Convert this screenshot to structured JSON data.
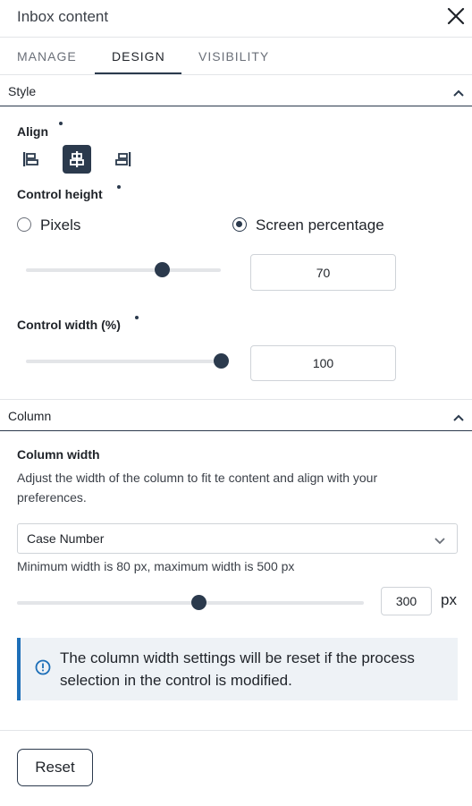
{
  "header": {
    "title": "Inbox content"
  },
  "tabs": [
    {
      "label": "MANAGE",
      "active": false
    },
    {
      "label": "DESIGN",
      "active": true
    },
    {
      "label": "VISIBILITY",
      "active": false
    }
  ],
  "style_section": {
    "title": "Style",
    "align": {
      "label": "Align",
      "options": [
        "align-left-icon",
        "align-center-icon",
        "align-right-icon"
      ],
      "selected": "center"
    },
    "control_height": {
      "label": "Control height",
      "options": [
        {
          "label": "Pixels",
          "selected": false
        },
        {
          "label": "Screen percentage",
          "selected": true
        }
      ],
      "value": "70",
      "slider_fraction": 0.7
    },
    "control_width": {
      "label": "Control width (%)",
      "value": "100",
      "slider_fraction": 1.0
    }
  },
  "column_section": {
    "title": "Column",
    "column_width": {
      "label": "Column width",
      "description": "Adjust the width of the column to fit te content and align with your preferences.",
      "select_value": "Case Number",
      "range_hint": "Minimum width is 80 px, maximum width is 500 px",
      "value": "300",
      "unit": "px",
      "min": 80,
      "max": 500
    },
    "info_message": "The column width settings will be reset if the process selection in the control is modified."
  },
  "footer": {
    "reset_label": "Reset"
  },
  "colors": {
    "primary": "#2b3a4d",
    "info_accent": "#1d6fb8",
    "info_bg": "#eef2f6",
    "divider": "#e3e5e8"
  }
}
